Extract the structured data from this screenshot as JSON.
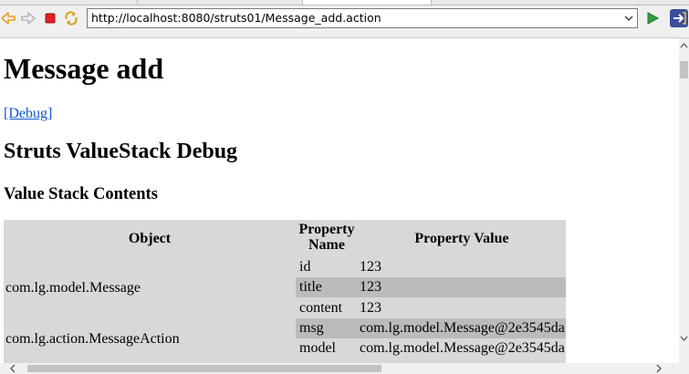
{
  "browser": {
    "url": "http://localhost:8080/struts01/Message_add.action",
    "icons": {
      "back": "back-arrow-icon",
      "forward": "forward-arrow-icon",
      "stop": "stop-icon",
      "refresh": "refresh-icon",
      "dropdown": "chevron-down-icon",
      "go": "go-arrow-icon",
      "extension": "extension-icon"
    },
    "colors": {
      "back_arrow": "#e8a21e",
      "stop": "#e02020",
      "go": "#2ea043",
      "link": "#1155cc"
    }
  },
  "page": {
    "heading": "Message add",
    "debug_link": "[Debug]",
    "debug_heading": "Struts ValueStack Debug",
    "stack_heading": "Value Stack Contents"
  },
  "table": {
    "headers": {
      "object": "Object",
      "property_name": "Property Name",
      "property_value": "Property Value"
    },
    "groups": [
      {
        "object": "com.lg.model.Message",
        "properties": [
          {
            "name": "id",
            "value": "123"
          },
          {
            "name": "title",
            "value": "123"
          },
          {
            "name": "content",
            "value": "123"
          }
        ]
      },
      {
        "object": "com.lg.action.MessageAction",
        "properties": [
          {
            "name": "msg",
            "value": "com.lg.model.Message@2e3545da"
          },
          {
            "name": "model",
            "value": "com.lg.model.Message@2e3545da"
          }
        ]
      }
    ]
  }
}
